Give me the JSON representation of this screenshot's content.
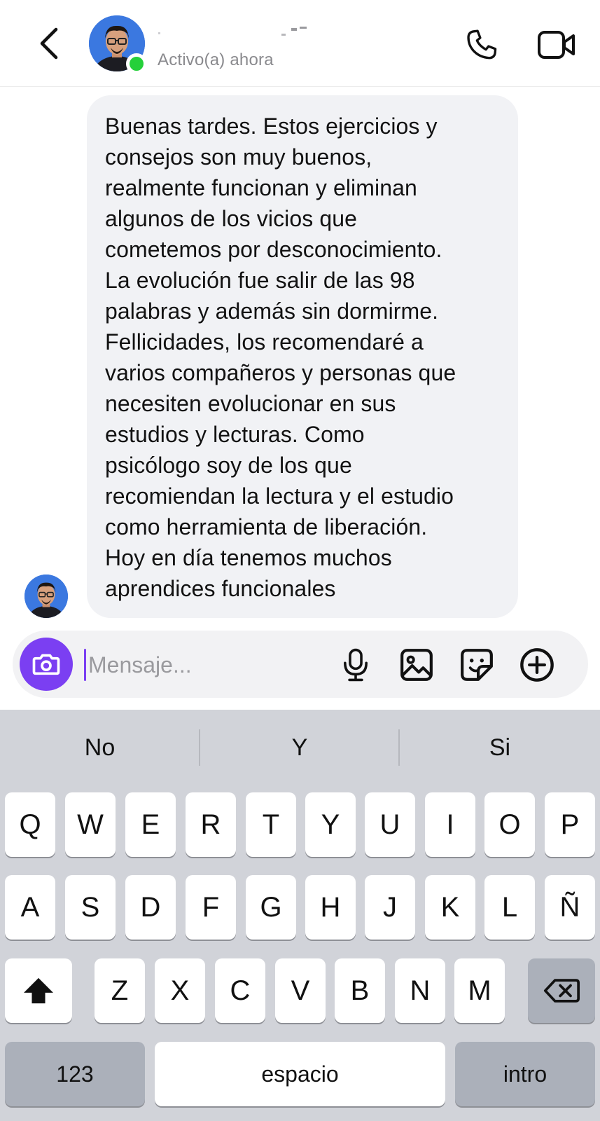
{
  "header": {
    "status": "Activo(a) ahora",
    "icons": {
      "back": "chevron-left-icon",
      "call": "phone-icon",
      "video": "video-camera-icon"
    }
  },
  "message": {
    "text": "Buenas tardes. Estos ejercicios y\nconsejos son muy buenos,\nrealmente funcionan y eliminan\nalgunos de los vicios que\ncometemos por desconocimiento.\nLa evolución fue salir de las 98\npalabras y además sin dormirme.\nFellicidades, los recomendaré a\nvarios compañeros y personas que\nnecesiten evolucionar en sus\nestudios y lecturas. Como\npsicólogo soy de los que\nrecomiendan la lectura y el estudio\ncomo herramienta de liberación.\nHoy en día tenemos muchos\naprendices funcionales"
  },
  "composer": {
    "placeholder": "Mensaje...",
    "icons": [
      "camera-icon",
      "microphone-icon",
      "image-icon",
      "sticker-icon",
      "plus-circle-icon"
    ]
  },
  "keyboard": {
    "suggestions": [
      "No",
      "Y",
      "Si"
    ],
    "row1": [
      "Q",
      "W",
      "E",
      "R",
      "T",
      "Y",
      "U",
      "I",
      "O",
      "P"
    ],
    "row2": [
      "A",
      "S",
      "D",
      "F",
      "G",
      "H",
      "J",
      "K",
      "L",
      "Ñ"
    ],
    "row3": [
      "Z",
      "X",
      "C",
      "V",
      "B",
      "N",
      "M"
    ],
    "numbers_label": "123",
    "space_label": "espacio",
    "return_label": "intro"
  },
  "colors": {
    "accent": "#7b3ff2",
    "online": "#25d03a",
    "bubble": "#f1f2f5",
    "keyboard_bg": "#d1d3d9"
  }
}
